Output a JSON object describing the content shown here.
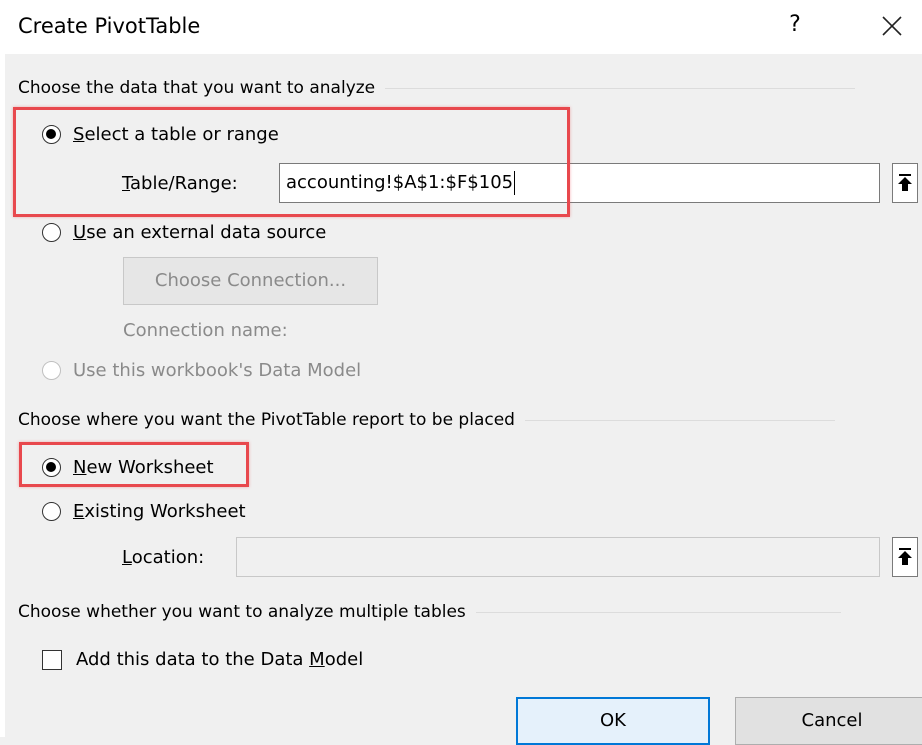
{
  "dialog": {
    "title": "Create PivotTable",
    "help_label": "?"
  },
  "sections": {
    "data_source": "Choose the data that you want to analyze",
    "placement": "Choose where you want the PivotTable report to be placed",
    "multiple_tables": "Choose whether you want to analyze multiple tables"
  },
  "data_source": {
    "select_range": {
      "accel": "S",
      "rest": "elect a table or range",
      "checked": true
    },
    "table_range": {
      "accel": "T",
      "rest": "able/Range:",
      "value": "accounting!$A$1:$F$105"
    },
    "external": {
      "accel": "U",
      "rest": "se an external data source",
      "checked": false
    },
    "choose_connection_label": "Choose Connection...",
    "connection_name_label": "Connection name:",
    "data_model": {
      "label": "Use this workbook's Data Model",
      "checked": false,
      "disabled": true
    }
  },
  "placement": {
    "new_worksheet": {
      "accel": "N",
      "rest": "ew Worksheet",
      "checked": true
    },
    "existing_worksheet": {
      "accel": "E",
      "rest": "xisting Worksheet",
      "checked": false
    },
    "location": {
      "accel": "L",
      "rest": "ocation:",
      "value": ""
    }
  },
  "multiple_tables": {
    "add_to_model": {
      "before": "Add this data to the Data ",
      "accel": "M",
      "after": "odel",
      "checked": false
    }
  },
  "buttons": {
    "ok": "OK",
    "cancel": "Cancel"
  },
  "colors": {
    "highlight": "#e8484d",
    "primary_border": "#0078d7",
    "dialog_bg": "#f0f0f0"
  }
}
